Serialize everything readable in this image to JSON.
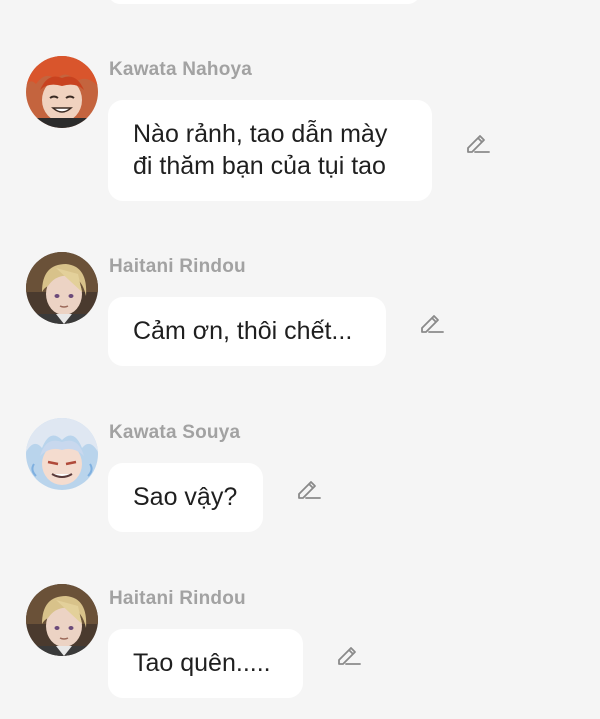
{
  "messages": [
    {
      "sender": "Kawata Nahoya",
      "text": "Nào rảnh, tao dẫn mày\nđi thăm bạn của tụi tao",
      "avatar_icon": "avatar-orange-hair-icon",
      "edit_icon": "pencil-icon"
    },
    {
      "sender": "Haitani Rindou",
      "text": "Cảm ơn, thôi chết...",
      "avatar_icon": "avatar-blonde-hair-icon",
      "edit_icon": "pencil-icon"
    },
    {
      "sender": "Kawata Souya",
      "text": "Sao vậy?",
      "avatar_icon": "avatar-white-blue-hair-icon",
      "edit_icon": "pencil-icon"
    },
    {
      "sender": "Haitani Rindou",
      "text": "Tao quên.....",
      "avatar_icon": "avatar-blonde-hair-icon",
      "edit_icon": "pencil-icon"
    }
  ],
  "colors": {
    "background": "#f5f5f5",
    "bubble": "#ffffff",
    "sender_name": "#a2a2a2",
    "message_text": "#1f1f1f",
    "edit_icon": "#8a8a8a"
  }
}
